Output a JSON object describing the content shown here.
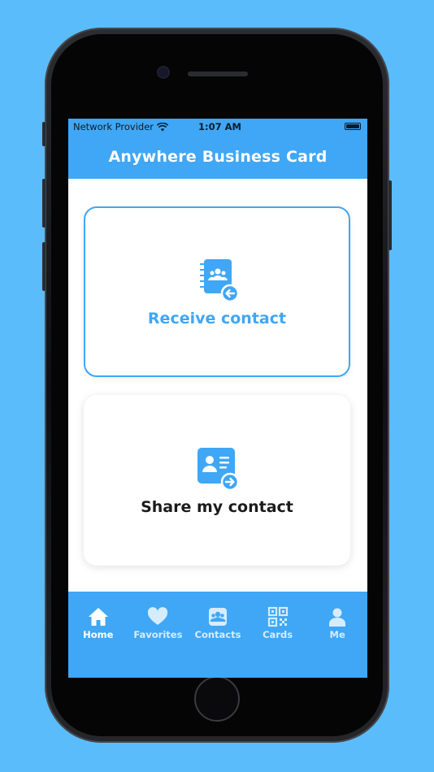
{
  "status_bar": {
    "carrier": "Network Provider",
    "time": "1:07 AM"
  },
  "app_bar": {
    "title": "Anywhere Business Card"
  },
  "cards": {
    "receive": {
      "label": "Receive contact",
      "icon": "contacts-book-receive-icon"
    },
    "share": {
      "label": "Share my contact",
      "icon": "contact-card-share-icon"
    }
  },
  "tabs": [
    {
      "label": "Home",
      "icon": "home-icon",
      "active": true
    },
    {
      "label": "Favorites",
      "icon": "heart-icon",
      "active": false
    },
    {
      "label": "Contacts",
      "icon": "contacts-icon",
      "active": false
    },
    {
      "label": "Cards",
      "icon": "qr-code-icon",
      "active": false
    },
    {
      "label": "Me",
      "icon": "person-icon",
      "active": false
    }
  ],
  "colors": {
    "background": "#5bbcfb",
    "primary": "#3fa7f5",
    "text_dark": "#1b1b1b"
  }
}
